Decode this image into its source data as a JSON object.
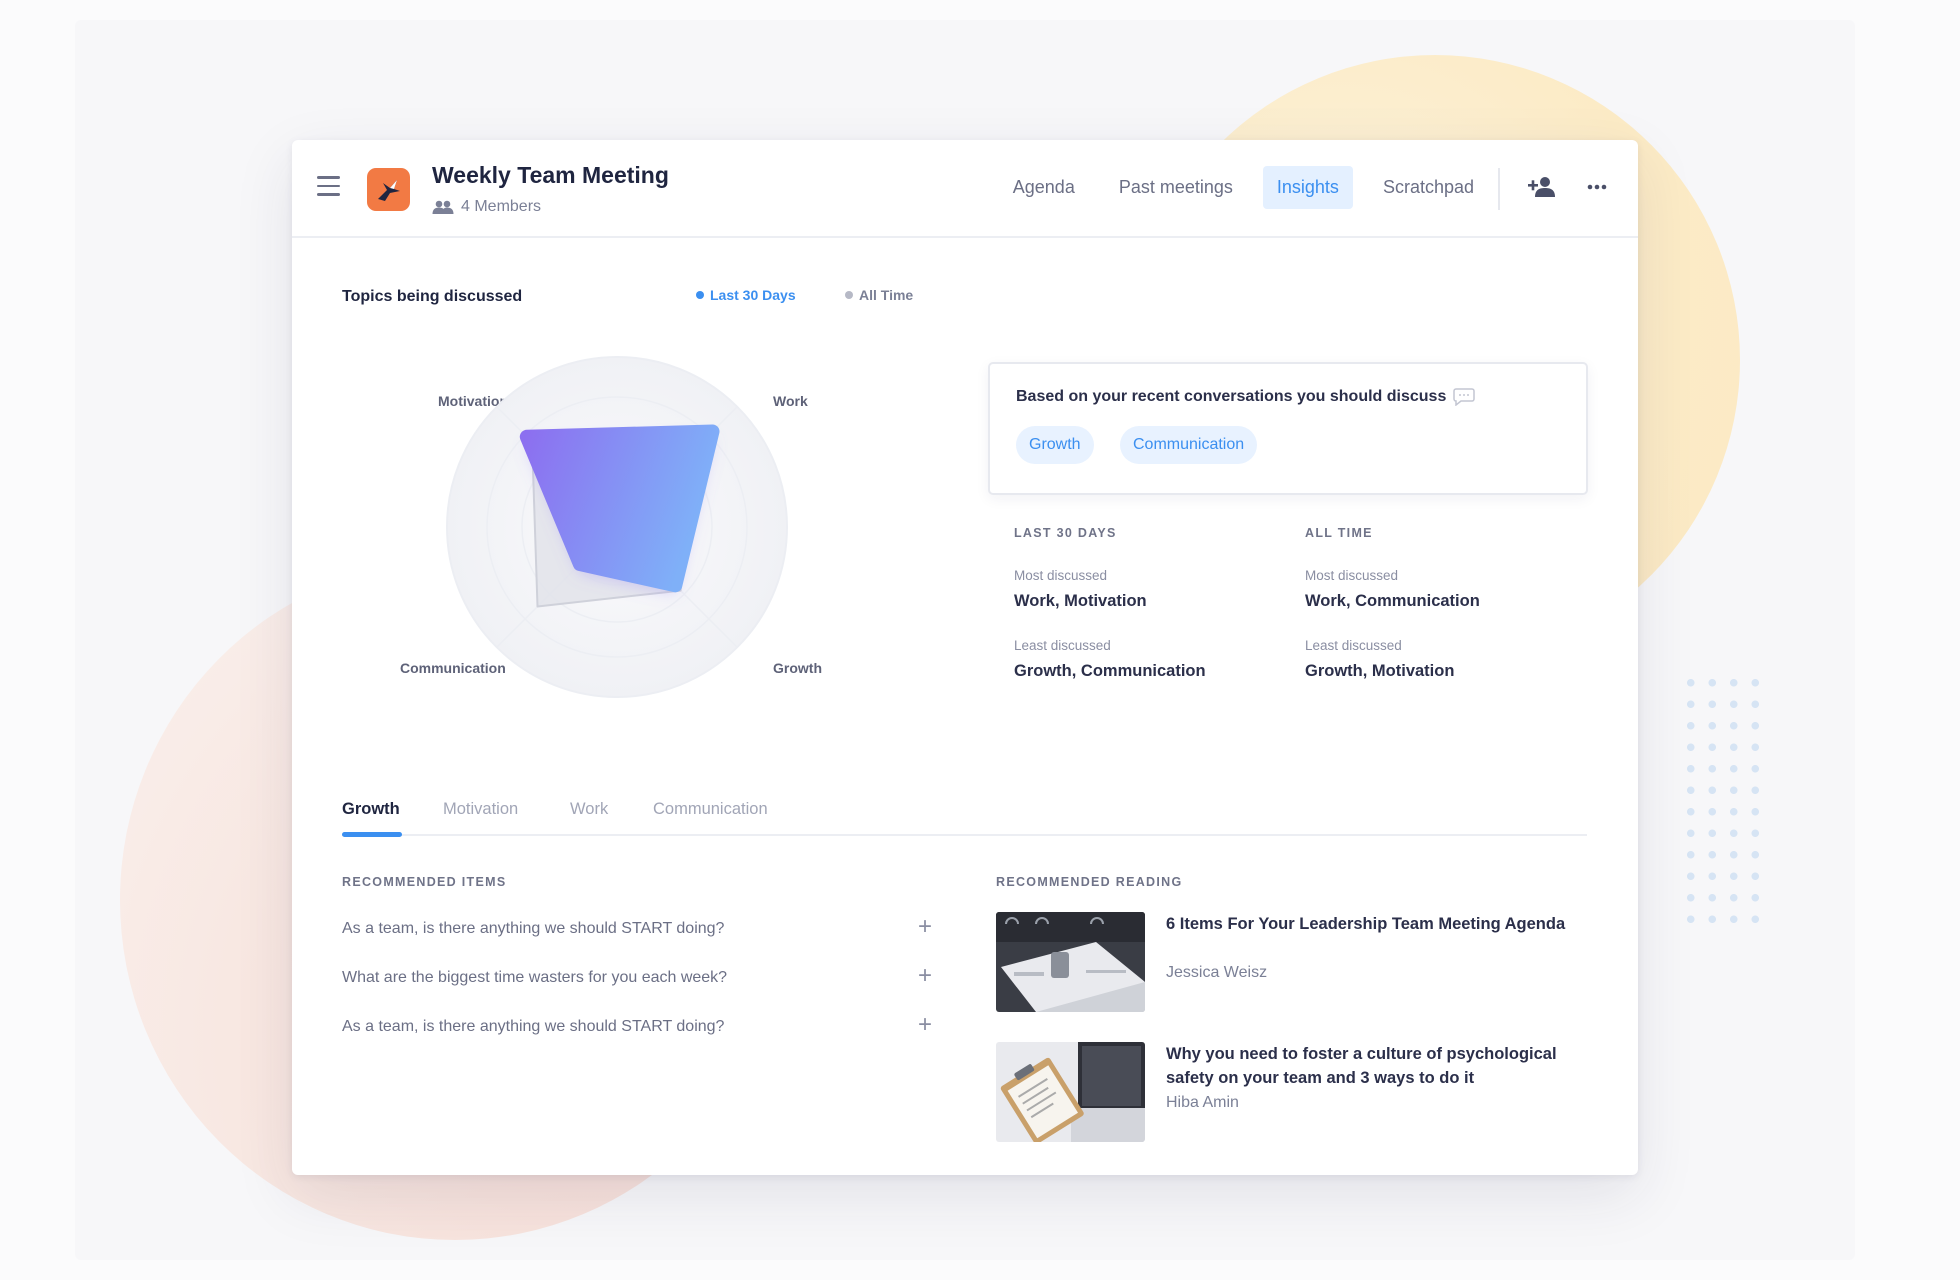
{
  "header": {
    "title": "Weekly Team Meeting",
    "members": "4 Members",
    "nav": [
      "Agenda",
      "Past meetings",
      "Insights",
      "Scratchpad"
    ],
    "active_nav": "Insights"
  },
  "topics": {
    "title": "Topics being discussed",
    "filters": [
      {
        "label": "Last 30 Days",
        "color": "#3b8ff0",
        "active": true
      },
      {
        "label": "All Time",
        "color": "#b6b9c6",
        "active": false
      }
    ],
    "axes": [
      "Motivation",
      "Work",
      "Growth",
      "Communication"
    ]
  },
  "chart_data": {
    "type": "radar",
    "axes": [
      "Motivation",
      "Work",
      "Growth",
      "Communication"
    ],
    "series": [
      {
        "values": [
          0.85,
          0.9,
          0.55,
          0.35
        ],
        "color": "#8f7cf6"
      },
      {
        "values": [
          0.8,
          0.7,
          0.6,
          0.75
        ],
        "color": "#d9dbe3"
      }
    ]
  },
  "suggest": {
    "text": "Based on your recent conversations you should discuss",
    "chips": [
      "Growth",
      "Communication"
    ]
  },
  "stats": {
    "last30": {
      "heading": "LAST 30 DAYS",
      "most_label": "Most discussed",
      "most_value": "Work, Motivation",
      "least_label": "Least discussed",
      "least_value": "Growth, Communication"
    },
    "alltime": {
      "heading": "ALL TIME",
      "most_label": "Most discussed",
      "most_value": "Work, Communication",
      "least_label": "Least discussed",
      "least_value": "Growth, Motivation"
    }
  },
  "topic_tabs": [
    "Growth",
    "Motivation",
    "Work",
    "Communication"
  ],
  "recommended_items": {
    "heading": "RECOMMENDED ITEMS",
    "items": [
      "As a team, is there anything we should START doing?",
      "What are the biggest time wasters for you each week?",
      "As a team, is there anything we should START doing?"
    ]
  },
  "recommended_reading": {
    "heading": "RECOMMENDED READING",
    "articles": [
      {
        "title": "6 Items For Your Leadership Team Meeting Agenda",
        "author": "Jessica Weisz"
      },
      {
        "title": "Why you need to foster a culture of psychological safety on your team and 3 ways to do it",
        "author": "Hiba Amin"
      }
    ]
  },
  "icons": {
    "menu": "hamburger-icon",
    "logo": "bird-logo-icon",
    "members": "people-icon",
    "add_person": "add-person-icon",
    "more": "more-icon",
    "chat": "chat-bubble-icon",
    "plus": "plus-icon"
  },
  "colors": {
    "accent": "#3b8ff0",
    "logo": "#f27a44"
  }
}
